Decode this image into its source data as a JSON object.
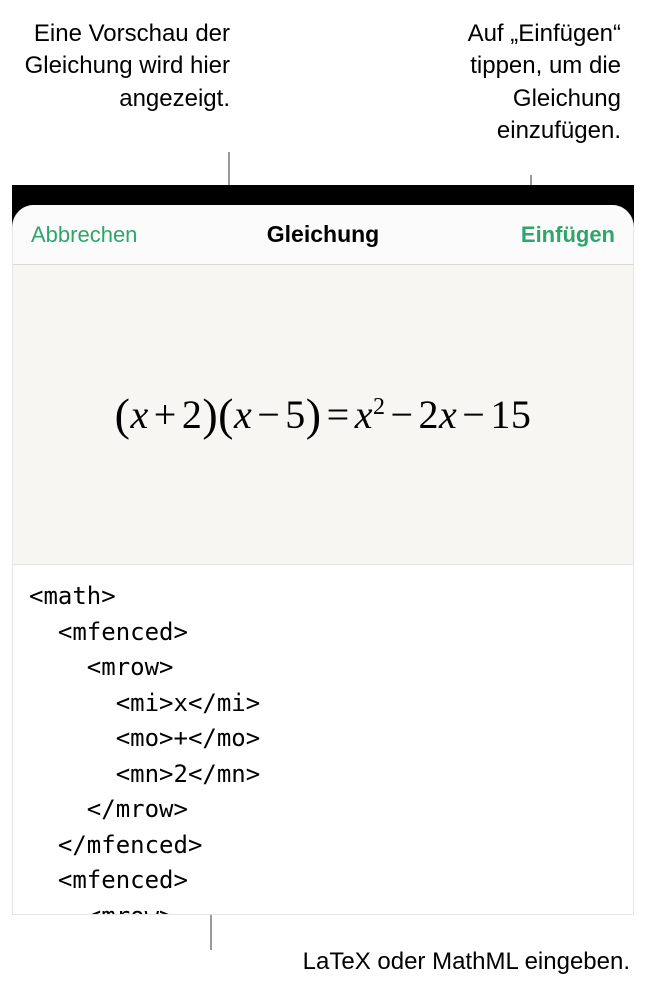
{
  "callouts": {
    "preview": "Eine Vorschau der Gleichung wird hier angezeigt.",
    "insert": "Auf „Einfügen“ tippen, um die Gleichung einzufügen.",
    "input": "LaTeX oder MathML eingeben."
  },
  "modal": {
    "cancel_label": "Abbrechen",
    "title": "Gleichung",
    "insert_label": "Einfügen"
  },
  "equation_display": "(x + 2)(x − 5) = x² − 2x − 15",
  "code_text": "<math>\n  <mfenced>\n    <mrow>\n      <mi>x</mi>\n      <mo>+</mo>\n      <mn>2</mn>\n    </mrow>\n  </mfenced>\n  <mfenced>\n    <mrow>"
}
